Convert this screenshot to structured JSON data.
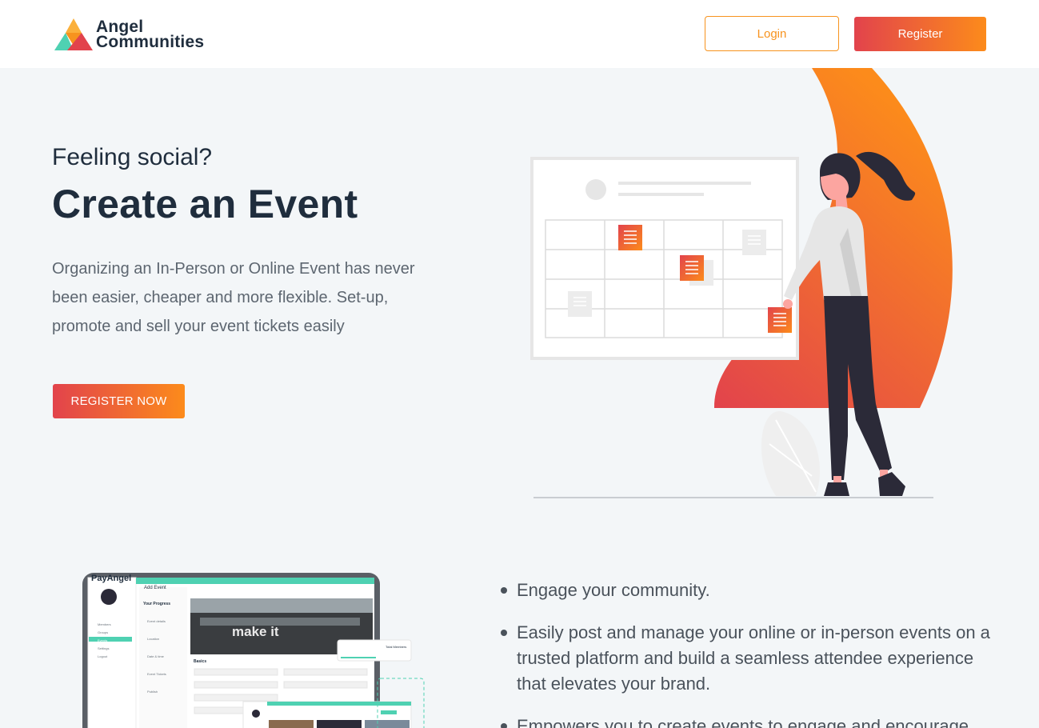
{
  "brand": {
    "line1": "Angel",
    "line2": "Communities"
  },
  "nav": {
    "login_label": "Login",
    "register_label": "Register"
  },
  "hero": {
    "subtitle": "Feeling social?",
    "title": "Create an Event",
    "description": "Organizing an In-Person or Online Event has never been easier, cheaper and more flexible. Set-up, promote and sell your event tickets easily",
    "cta_label": "REGISTER NOW"
  },
  "preview": {
    "app_logo": "PayAngel",
    "page_heading": "Add Event",
    "progress_title": "Your Progress",
    "banner_text": "make it",
    "section_label": "Basics",
    "popup_label": "Total Members",
    "menu": [
      "Members",
      "Groups",
      "Events",
      "Settings",
      "Logout"
    ],
    "steps": [
      "Event details",
      "Location",
      "Date & time",
      "Event Tickets",
      "Publish"
    ]
  },
  "features": [
    "Engage your community.",
    "Easily post and manage your online or in-person events on a trusted platform and build a seamless attendee experience that elevates your brand.",
    "Empowers you to create events to engage and encourage"
  ],
  "colors": {
    "accent_start": "#e2434c",
    "accent_end": "#fc8b1b",
    "login_border": "#f7931e",
    "teal": "#4fd1b2"
  }
}
